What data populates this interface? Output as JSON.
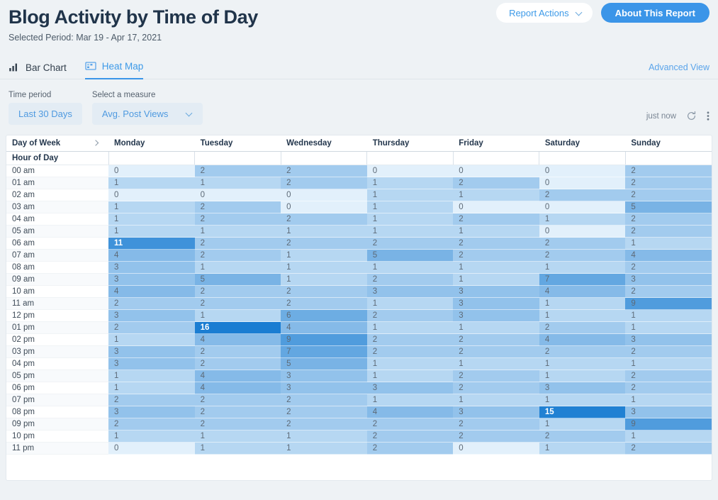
{
  "header": {
    "title": "Blog Activity by Time of Day",
    "subtitle": "Selected Period: Mar 19 - Apr 17, 2021",
    "report_actions_label": "Report Actions",
    "about_label": "About This Report"
  },
  "tabs": [
    {
      "label": "Bar Chart",
      "icon": "bar-chart-icon",
      "active": false
    },
    {
      "label": "Heat Map",
      "icon": "heat-map-icon",
      "active": true
    }
  ],
  "advanced_view_label": "Advanced View",
  "controls": {
    "time_period_label": "Time period",
    "time_period_value": "Last 30 Days",
    "measure_label": "Select a measure",
    "measure_value": "Avg. Post Views",
    "refresh_text": "just now",
    "refresh_icon": "refresh-icon",
    "more_icon": "kebab-menu-icon"
  },
  "colors": {
    "accent": "#3b95e8",
    "link": "#5aa4ea",
    "page_bg": "#eef2f5",
    "heat_min": "#e2f0fb",
    "heat_max": "#2286d9"
  },
  "table": {
    "corner_header": "Day of Week",
    "row_header": "Hour of Day",
    "columns": [
      "Monday",
      "Tuesday",
      "Wednesday",
      "Thursday",
      "Friday",
      "Saturday",
      "Sunday"
    ],
    "rows": [
      "00 am",
      "01 am",
      "02 am",
      "03 am",
      "04 am",
      "05 am",
      "06 am",
      "07 am",
      "08 am",
      "09 am",
      "10 am",
      "11 am",
      "12 pm",
      "01 pm",
      "02 pm",
      "03 pm",
      "04 pm",
      "05 pm",
      "06 pm",
      "07 pm",
      "08 pm",
      "09 pm",
      "10 pm",
      "11 pm"
    ]
  },
  "chart_data": {
    "type": "heatmap",
    "title": "Blog Activity by Time of Day",
    "subtitle": "Selected Period: Mar 19 - Apr 17, 2021",
    "measure": "Avg. Post Views",
    "xlabel": "Day of Week",
    "ylabel": "Hour of Day",
    "x": [
      "Monday",
      "Tuesday",
      "Wednesday",
      "Thursday",
      "Friday",
      "Saturday",
      "Sunday"
    ],
    "y": [
      "00 am",
      "01 am",
      "02 am",
      "03 am",
      "04 am",
      "05 am",
      "06 am",
      "07 am",
      "08 am",
      "09 am",
      "10 am",
      "11 am",
      "12 pm",
      "01 pm",
      "02 pm",
      "03 pm",
      "04 pm",
      "05 pm",
      "06 pm",
      "07 pm",
      "08 pm",
      "09 pm",
      "10 pm",
      "11 pm"
    ],
    "zmin": 0,
    "zmax": 16,
    "values": [
      [
        0,
        2,
        2,
        0,
        0,
        0,
        2
      ],
      [
        1,
        1,
        2,
        1,
        2,
        0,
        2
      ],
      [
        0,
        0,
        0,
        1,
        1,
        2,
        2
      ],
      [
        1,
        2,
        0,
        1,
        0,
        0,
        5
      ],
      [
        1,
        2,
        2,
        1,
        2,
        1,
        2
      ],
      [
        1,
        1,
        1,
        1,
        1,
        0,
        2
      ],
      [
        11,
        2,
        2,
        2,
        2,
        2,
        1
      ],
      [
        4,
        2,
        1,
        5,
        2,
        2,
        4
      ],
      [
        3,
        1,
        1,
        1,
        1,
        1,
        2
      ],
      [
        3,
        5,
        1,
        2,
        1,
        7,
        3
      ],
      [
        4,
        2,
        2,
        3,
        3,
        4,
        2
      ],
      [
        2,
        2,
        2,
        1,
        3,
        1,
        9
      ],
      [
        3,
        1,
        6,
        2,
        3,
        1,
        1
      ],
      [
        2,
        16,
        4,
        1,
        1,
        2,
        1
      ],
      [
        1,
        4,
        9,
        2,
        2,
        4,
        3
      ],
      [
        3,
        2,
        7,
        2,
        2,
        2,
        2
      ],
      [
        3,
        2,
        5,
        1,
        1,
        1,
        1
      ],
      [
        1,
        4,
        3,
        1,
        2,
        1,
        2
      ],
      [
        1,
        4,
        3,
        3,
        2,
        3,
        2
      ],
      [
        2,
        2,
        2,
        1,
        1,
        1,
        1
      ],
      [
        3,
        2,
        2,
        4,
        3,
        15,
        3
      ],
      [
        2,
        2,
        2,
        2,
        2,
        1,
        9
      ],
      [
        1,
        1,
        1,
        2,
        2,
        2,
        1
      ],
      [
        0,
        1,
        1,
        2,
        0,
        1,
        2
      ]
    ]
  }
}
